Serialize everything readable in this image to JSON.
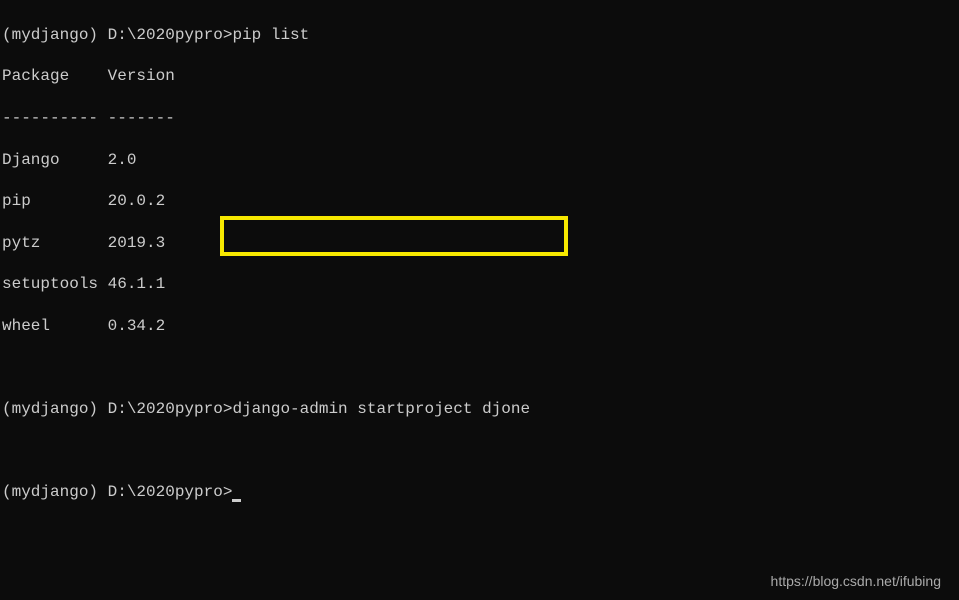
{
  "terminal": {
    "line1_prompt": "(mydjango) D:\\2020pypro>",
    "line1_cmd": "pip list",
    "header_package": "Package   ",
    "header_version": " Version",
    "divider_package": "----------",
    "divider_version": " -------",
    "packages": [
      {
        "name": "Django    ",
        "version": " 2.0"
      },
      {
        "name": "pip       ",
        "version": " 20.0.2"
      },
      {
        "name": "pytz      ",
        "version": " 2019.3"
      },
      {
        "name": "setuptools",
        "version": " 46.1.1"
      },
      {
        "name": "wheel     ",
        "version": " 0.34.2"
      }
    ],
    "line2_prompt": "(mydjango) D:\\2020pypro>",
    "line2_cmd": "django-admin startproject djone",
    "line3_prompt": "(mydjango) D:\\2020pypro>"
  },
  "watermark": "https://blog.csdn.net/ifubing"
}
